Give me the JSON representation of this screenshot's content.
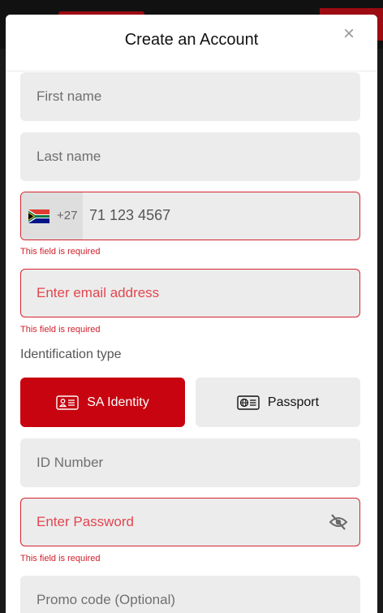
{
  "modal": {
    "title": "Create an Account",
    "close_symbol": "×"
  },
  "form": {
    "first_name": {
      "placeholder": "First name"
    },
    "last_name": {
      "placeholder": "Last name"
    },
    "phone": {
      "country_code": "+27",
      "flag": "south-africa-flag-icon",
      "value": "71 123 4567",
      "error": "This field is required"
    },
    "email": {
      "placeholder": "Enter email address",
      "error": "This field is required"
    },
    "identification": {
      "label": "Identification type",
      "options": [
        {
          "label": "SA Identity",
          "icon": "id-card-icon",
          "selected": true
        },
        {
          "label": "Passport",
          "icon": "passport-icon",
          "selected": false
        }
      ]
    },
    "id_number": {
      "placeholder": "ID Number"
    },
    "password": {
      "placeholder": "Enter Password",
      "error": "This field is required",
      "toggle_icon": "eye-off-icon"
    },
    "promo": {
      "placeholder": "Promo code (Optional)"
    }
  },
  "colors": {
    "accent": "#c7040f",
    "error": "#d01f2a",
    "field_bg": "#ececec"
  }
}
